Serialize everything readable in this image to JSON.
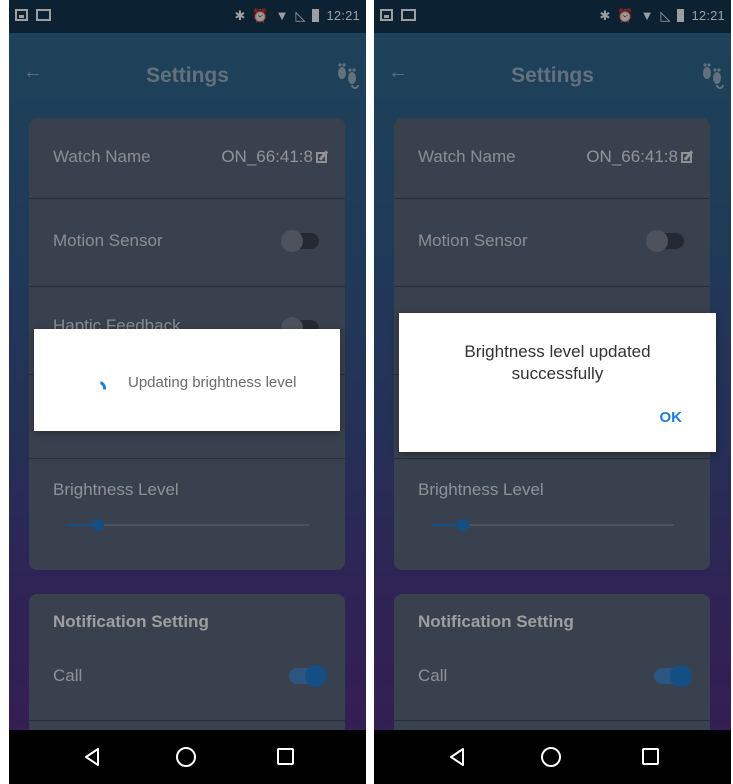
{
  "status_bar": {
    "time": "12:21"
  },
  "header": {
    "title": "Settings"
  },
  "settings": {
    "watch_name_label": "Watch Name",
    "watch_name_value": "ON_66:41:8",
    "motion_sensor_label": "Motion Sensor",
    "motion_sensor_on": false,
    "haptic_feedback_label": "Haptic Feedback",
    "brightness_label": "Brightness Level",
    "brightness_level": 0.13
  },
  "notification": {
    "title": "Notification Setting",
    "call_label": "Call",
    "call_on": true
  },
  "progress_dialog": {
    "message": "Updating brightness level"
  },
  "alert_dialog": {
    "message": "Brightness level updated successfully",
    "ok_label": "OK"
  },
  "colors": {
    "accent": "#1f7fd6",
    "card": "#5d6a7f",
    "nav_bar": "#000000"
  },
  "icons": [
    "back-arrow-icon",
    "feet-icon",
    "edit-icon",
    "bluetooth-icon",
    "alarm-icon",
    "wifi-icon",
    "signal-icon",
    "battery-icon"
  ]
}
